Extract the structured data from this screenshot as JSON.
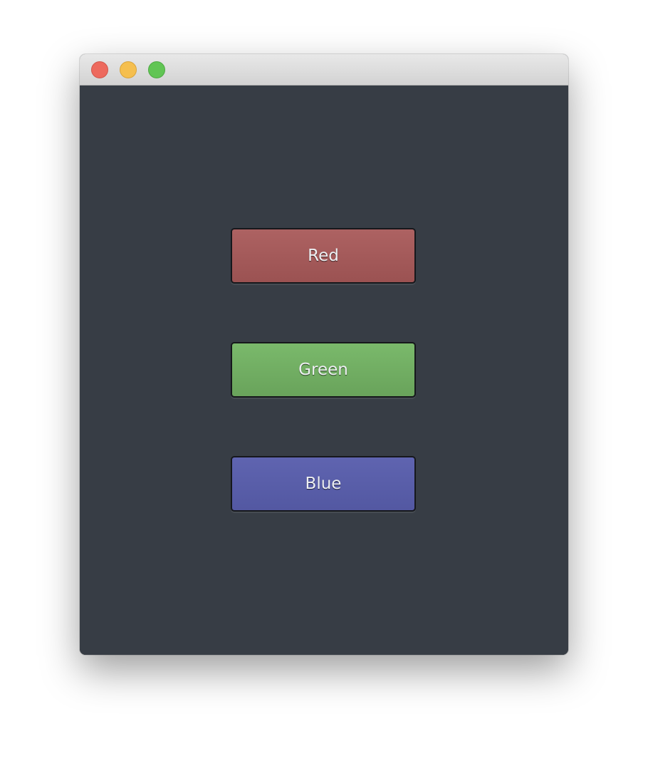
{
  "window": {
    "controls": {
      "close": "close-icon",
      "minimize": "minimize-icon",
      "zoom": "zoom-icon"
    }
  },
  "buttons": [
    {
      "label": "Red",
      "color": "#a55a5a"
    },
    {
      "label": "Green",
      "color": "#71ae63"
    },
    {
      "label": "Blue",
      "color": "#595ea9"
    }
  ]
}
